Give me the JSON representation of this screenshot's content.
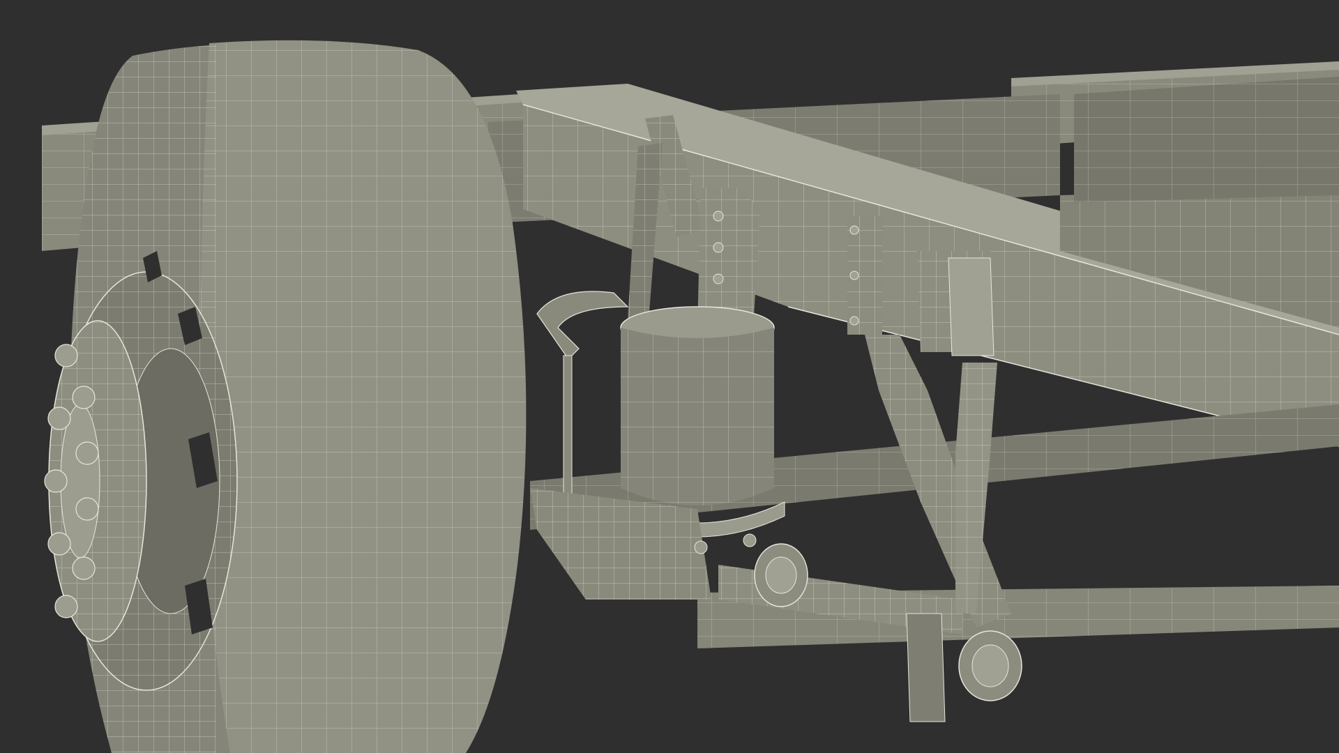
{
  "scene": {
    "subject": "truck-chassis-rear-suspension-wireframe-render",
    "colors": {
      "background": "#2f2f2f",
      "surface": "#8a8a7c",
      "surface_light": "#a0a093",
      "surface_dark": "#6c6c62",
      "wire": "#e6e6dc",
      "shadow": "#545450"
    }
  }
}
